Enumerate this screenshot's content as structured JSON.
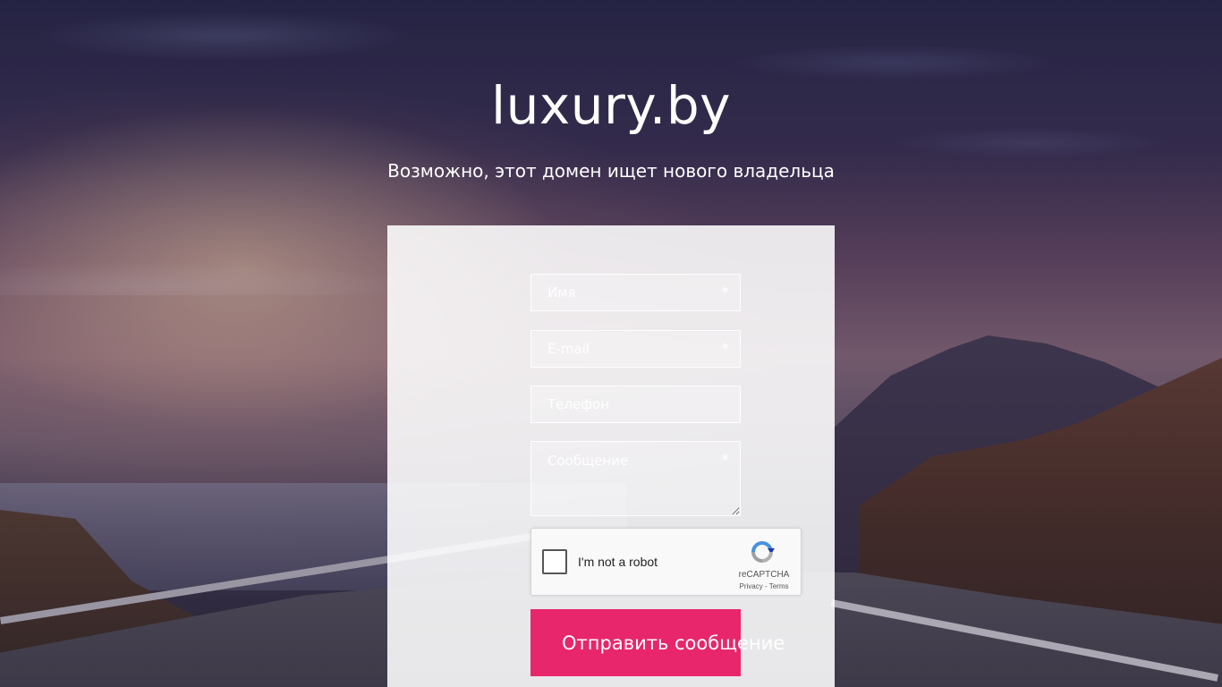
{
  "header": {
    "title": "luxury.by",
    "subtitle": "Возможно, этот домен ищет нового владельца"
  },
  "form": {
    "name": {
      "placeholder": "Имя",
      "required_mark": "*"
    },
    "email": {
      "placeholder": "E-mail",
      "required_mark": "*"
    },
    "phone": {
      "placeholder": "Телефон"
    },
    "message": {
      "placeholder": "Сообщение",
      "required_mark": "*"
    },
    "submit_label": "Отправить сообщение"
  },
  "recaptcha": {
    "label": "I'm not a robot",
    "brand": "reCAPTCHA",
    "links": "Privacy - Terms"
  },
  "colors": {
    "accent": "#e8266b",
    "recaptcha_blue": "#4a90e2",
    "recaptcha_gray": "#b0b0b0"
  },
  "icons": {
    "recaptcha_logo": "recaptcha-logo-icon",
    "checkbox": "checkbox-empty-icon"
  }
}
